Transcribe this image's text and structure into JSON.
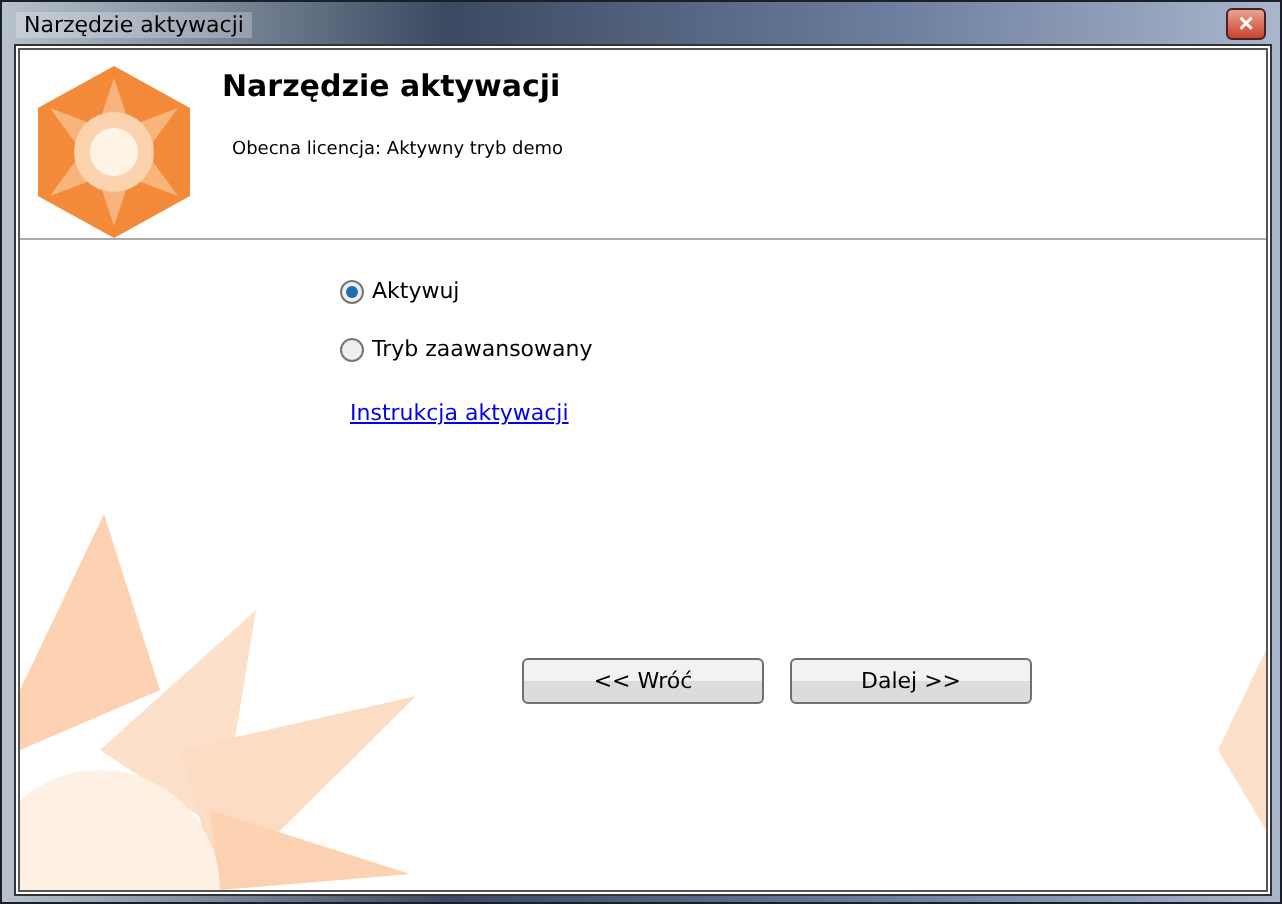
{
  "window": {
    "title": "Narzędzie aktywacji",
    "close": "×"
  },
  "header": {
    "title": "Narzędzie aktywacji",
    "subtitle": "Obecna licencja: Aktywny tryb demo"
  },
  "options": [
    {
      "label": "Aktywuj",
      "selected": true
    },
    {
      "label": "Tryb zaawansowany",
      "selected": false
    }
  ],
  "link": "Instrukcja aktywacji",
  "buttons": [
    {
      "label": "<< Wróć"
    },
    {
      "label": "Dalej >>"
    }
  ]
}
